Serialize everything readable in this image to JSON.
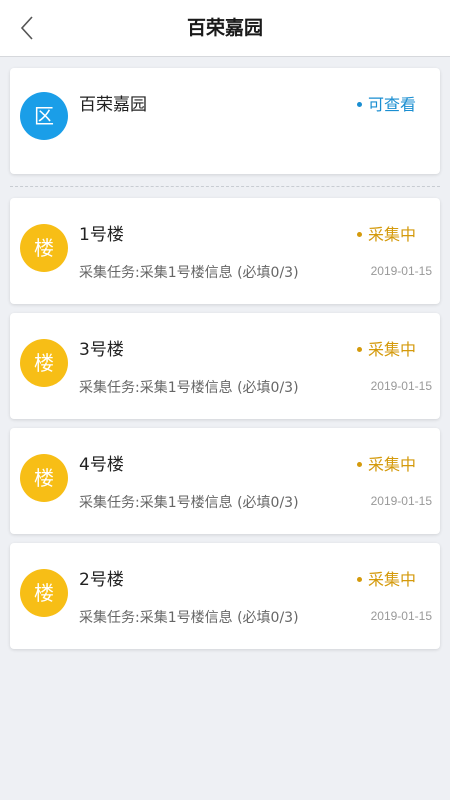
{
  "header": {
    "title": "百荣嘉园"
  },
  "area": {
    "avatar_text": "区",
    "name": "百荣嘉园",
    "status": "可查看"
  },
  "buildings": [
    {
      "avatar_text": "楼",
      "name": "1号楼",
      "status": "采集中",
      "task": "采集任务:采集1号楼信息 (必填0/3)",
      "date": "2019-01-15"
    },
    {
      "avatar_text": "楼",
      "name": "3号楼",
      "status": "采集中",
      "task": "采集任务:采集1号楼信息 (必填0/3)",
      "date": "2019-01-15"
    },
    {
      "avatar_text": "楼",
      "name": "4号楼",
      "status": "采集中",
      "task": "采集任务:采集1号楼信息 (必填0/3)",
      "date": "2019-01-15"
    },
    {
      "avatar_text": "楼",
      "name": "2号楼",
      "status": "采集中",
      "task": "采集任务:采集1号楼信息 (必填0/3)",
      "date": "2019-01-15"
    }
  ],
  "colors": {
    "area_avatar": "#1a9ee8",
    "building_avatar": "#f7be16",
    "area_status": "#1a8ed1",
    "building_status": "#d49a0c"
  }
}
